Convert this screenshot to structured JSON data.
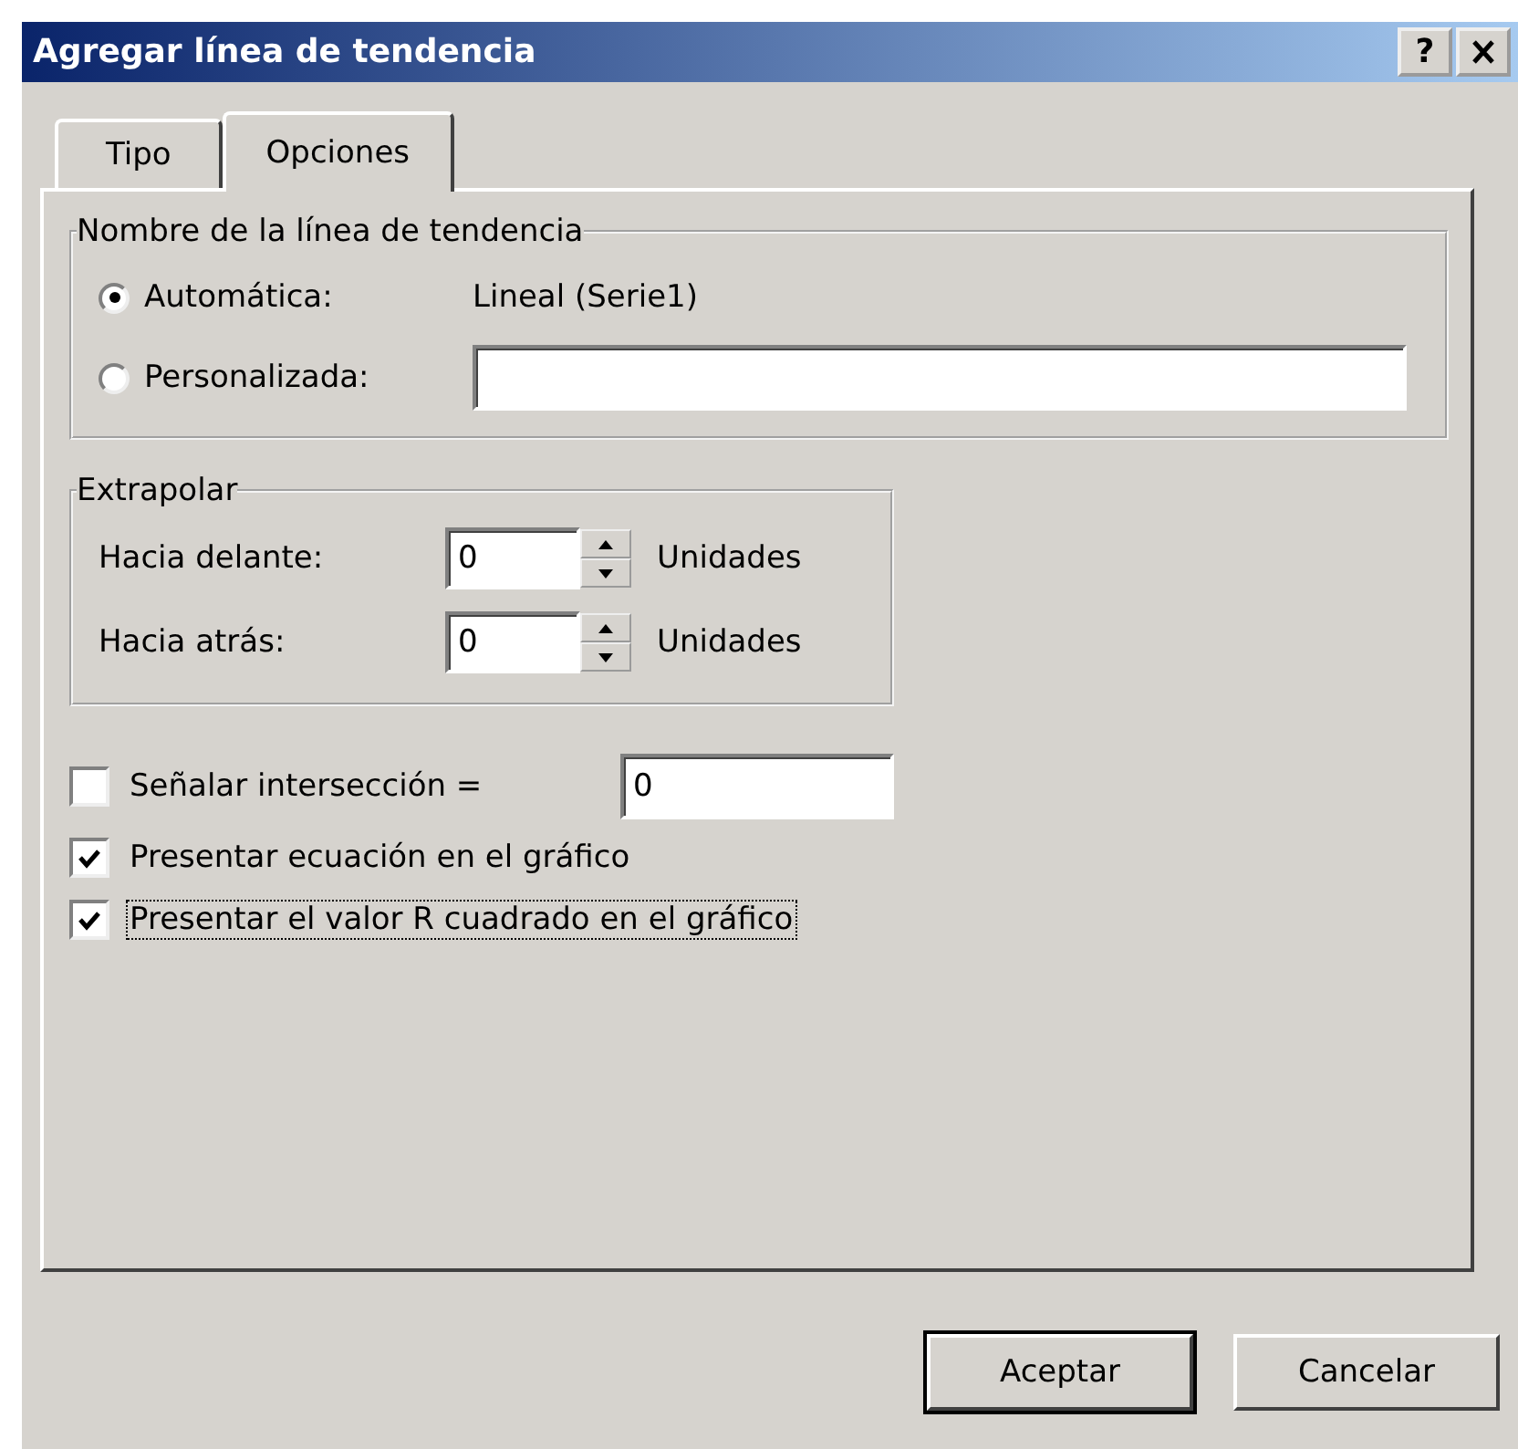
{
  "window": {
    "title": "Agregar línea de tendencia",
    "help_button": "?"
  },
  "tabs": [
    {
      "label": "Tipo",
      "selected": false
    },
    {
      "label": "Opciones",
      "selected": true
    }
  ],
  "name_group": {
    "legend": "Nombre de la línea de tendencia",
    "options": [
      {
        "label": "Automática:",
        "selected": true,
        "kind": "value",
        "value": "Lineal (Serie1)"
      },
      {
        "label": "Personalizada:",
        "selected": false,
        "kind": "field"
      }
    ]
  },
  "extrapolate_group": {
    "legend": "Extrapolar",
    "rows": [
      {
        "label": "Hacia delante:",
        "value": "0",
        "unit": "Unidades"
      },
      {
        "label": "Hacia atrás:",
        "value": "0",
        "unit": "Unidades"
      }
    ]
  },
  "checks": [
    {
      "label": "Señalar intersección =",
      "checked": false,
      "focused": false,
      "kind": "field",
      "value": "0"
    },
    {
      "label": "Presentar ecuación en el gráfico",
      "checked": true,
      "focused": false,
      "kind": "plain"
    },
    {
      "label": "Presentar el valor R cuadrado en el gráfico",
      "checked": true,
      "focused": true,
      "kind": "plain"
    }
  ],
  "buttons": [
    {
      "label": "Aceptar",
      "default": true
    },
    {
      "label": "Cancelar",
      "default": false
    }
  ]
}
